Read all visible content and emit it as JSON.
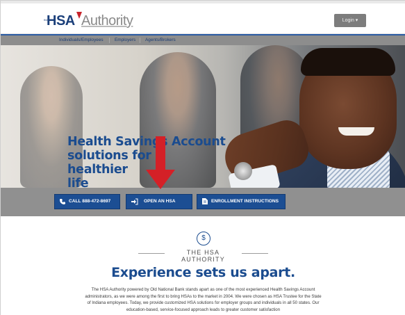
{
  "header": {
    "logo": {
      "prefix": "the",
      "brand": "HSA",
      "suffix": "Authority"
    },
    "login_label": "Login ▾"
  },
  "nav": {
    "items": [
      {
        "label": "Individuals/Employees"
      },
      {
        "label": "Employers"
      },
      {
        "label": "Agents/Brokers"
      }
    ]
  },
  "hero": {
    "headline_lines": [
      "Health Savings Account",
      "solutions for a healthier",
      "life"
    ]
  },
  "cta": {
    "call": {
      "icon": "phone-icon",
      "label": "CALL 888-472-8697"
    },
    "open": {
      "icon": "sign-in-icon",
      "label": "OPEN AN HSA"
    },
    "enroll": {
      "icon": "document-icon",
      "label": "ENROLLMENT INSTRUCTIONS"
    }
  },
  "intro": {
    "icon": "dollar-circle-icon",
    "icon_glyph": "$",
    "eyebrow": "THE HSA AUTHORITY",
    "title": "Experience sets us apart.",
    "body": "The HSA Authority powered by Old National Bank stands apart as one of the most experienced Health Savings Account administrators, as we were among the first to bring HSAs to the market in 2004. We were chosen as HSA Trustee for the State of Indiana employees. Today, we provide customized HSA solutions for employer groups and individuals in all 50 states. Our education-based, service-focused approach leads to greater customer satisfaction"
  },
  "colors": {
    "brand_blue": "#1b4c8f",
    "cta_blue": "#1c4e93",
    "arrow_red": "#d42027",
    "nav_gray": "#8d8d8d"
  }
}
